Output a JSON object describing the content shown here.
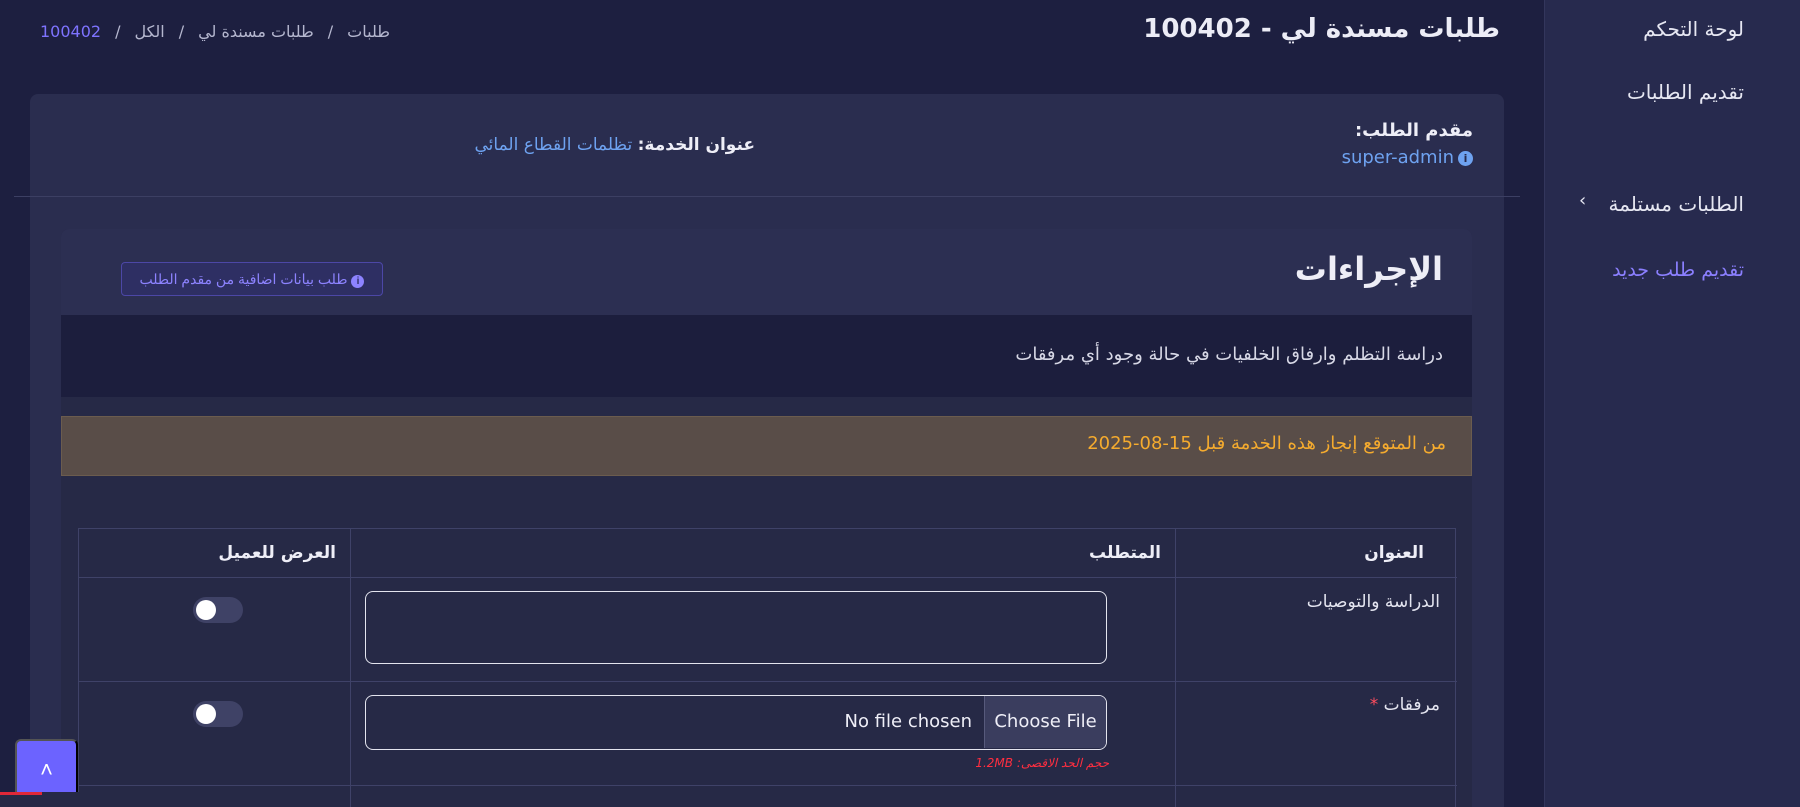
{
  "page": {
    "title": "طلبات مسندة لي - 100402"
  },
  "breadcrumb": {
    "items": [
      "طلبات",
      "طلبات مسندة لي",
      "الكل",
      "100402"
    ],
    "separator": "/"
  },
  "sidebar": {
    "items": [
      {
        "label": "لوحة التحكم"
      },
      {
        "label": "تقديم الطلبات"
      },
      {
        "label": "الطلبات مستلمة"
      },
      {
        "label": "تقديم طلب جديد"
      }
    ],
    "chevron": "›"
  },
  "request": {
    "applicant_label": "مقدم الطلب:",
    "applicant_value": "super-admin",
    "service_label": "عنوان الخدمة:",
    "service_value": "تظلمات القطاع المائي"
  },
  "actions": {
    "title": "الإجراءات",
    "extra_data_button": "طلب بيانات اضافية من مقدم الطلب",
    "description": "دراسة التظلم وارفاق الخلفيات في حالة وجود أي مرفقات",
    "deadline": "من المتوقع إنجاز هذه الخدمة قبل 15-08-2025"
  },
  "table": {
    "headers": {
      "title": "العنوان",
      "requirement": "المتطلب",
      "show_to_client": "العرض للعميل"
    },
    "rows": [
      {
        "title": "الدراسة والتوصيات",
        "required": false,
        "input_type": "textarea",
        "show_to_client": false
      },
      {
        "title": "مرفقات",
        "required": true,
        "required_mark": "*",
        "input_type": "file",
        "file_button": "Choose File",
        "file_status": "No file chosen",
        "file_hint": "حجم الحد الاقصى: 1.2MB",
        "show_to_client": false
      }
    ]
  },
  "fab": {
    "icon": "chevron-up-icon",
    "glyph": "˄"
  },
  "colors": {
    "background": "#1d1f40",
    "card": "#2a2d4f",
    "accent": "#6c63ff",
    "link": "#6ea2f0",
    "warning_text": "#f5ab2e",
    "required": "#ff4d5e"
  }
}
